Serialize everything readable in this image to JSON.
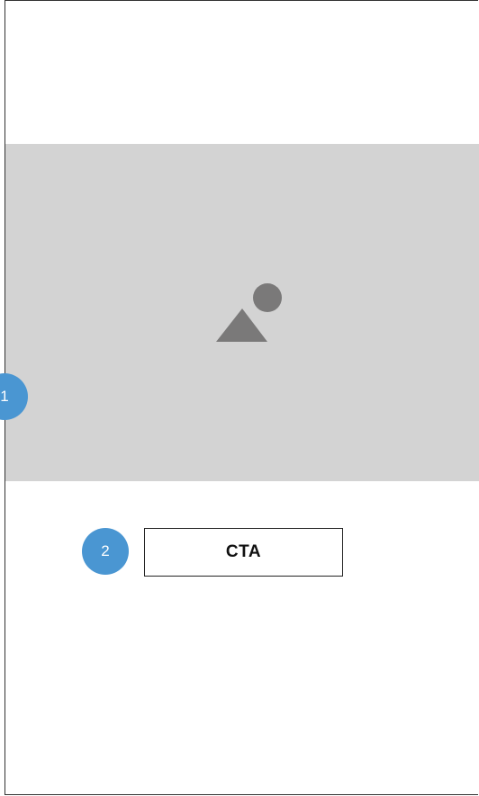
{
  "colors": {
    "frame_border": "#333333",
    "hero_background": "#d3d3d3",
    "image_icon": "#7a7979",
    "badge": "#4a96d2",
    "cta_border": "#222222"
  },
  "hero": {
    "icon": "image-placeholder-icon"
  },
  "annotations": {
    "badge_1": "1",
    "badge_2": "2"
  },
  "cta": {
    "label": "CTA"
  }
}
